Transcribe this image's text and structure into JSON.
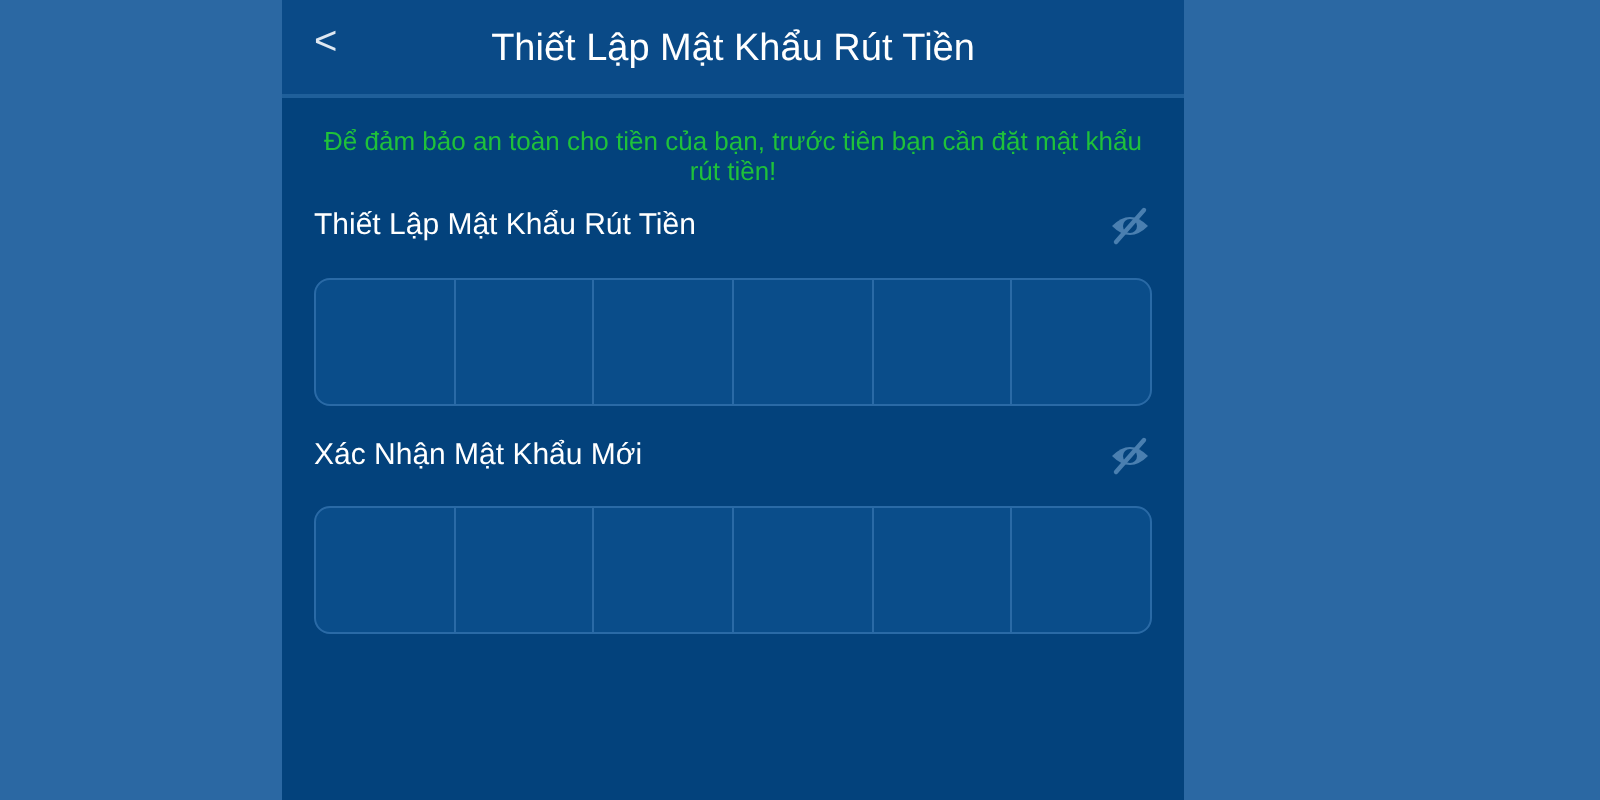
{
  "header": {
    "back": "<",
    "title": "Thiết Lập Mật Khẩu Rút Tiền"
  },
  "notice": "Để đảm bảo an toàn cho tiền của bạn, trước tiên bạn cần đặt mật khẩu rút tiền!",
  "fields": [
    {
      "label": "Thiết Lập Mật Khẩu Rút Tiền",
      "visible": false
    },
    {
      "label": "Xác Nhận Mật Khẩu Mới",
      "visible": false
    }
  ]
}
